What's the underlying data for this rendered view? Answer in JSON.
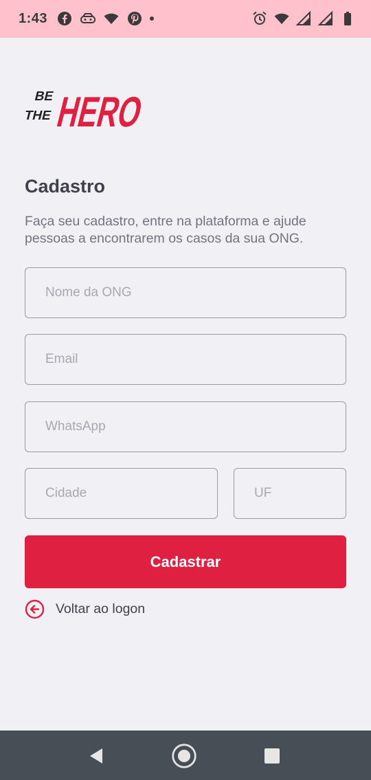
{
  "status_bar": {
    "time": "1:43",
    "left_icons": [
      "facebook-icon",
      "game-controller-icon",
      "wifi-status-icon",
      "pinterest-icon",
      "notification-dot-icon"
    ],
    "right_icons": [
      "alarm-icon",
      "wifi-icon",
      "signal-icon",
      "signal-icon",
      "battery-icon"
    ]
  },
  "logo": {
    "line1": "BE",
    "line2": "THE",
    "hero": "HERO",
    "color": "#e02041"
  },
  "page": {
    "title": "Cadastro",
    "subtitle": "Faça seu cadastro, entre na plataforma e ajude pessoas a encontrarem os casos da sua ONG."
  },
  "form": {
    "name": {
      "placeholder": "Nome da ONG",
      "value": ""
    },
    "email": {
      "placeholder": "Email",
      "value": ""
    },
    "whatsapp": {
      "placeholder": "WhatsApp",
      "value": ""
    },
    "city": {
      "placeholder": "Cidade",
      "value": ""
    },
    "uf": {
      "placeholder": "UF",
      "value": ""
    },
    "submit_label": "Cadastrar"
  },
  "back_link": {
    "label": "Voltar ao logon",
    "icon": "arrow-left-circle-icon"
  },
  "colors": {
    "accent": "#e02041",
    "status_bar": "#ffc1cc",
    "nav_bar": "#474e55",
    "background": "#f0f0f5"
  },
  "nav_bar": {
    "buttons": [
      "back-triangle-icon",
      "home-circle-icon",
      "recents-square-icon"
    ]
  }
}
